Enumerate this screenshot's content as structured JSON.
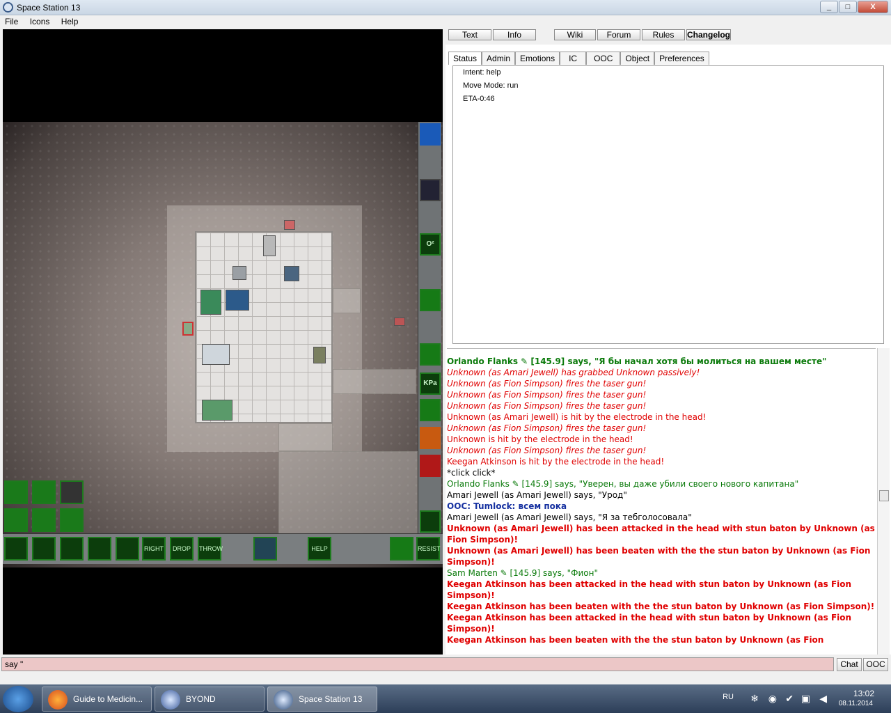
{
  "window": {
    "title": "Space Station 13",
    "buttons": [
      "_",
      "□",
      "X"
    ]
  },
  "menu": [
    "File",
    "Icons",
    "Help"
  ],
  "top_buttons": [
    "Text",
    "Info",
    "Wiki",
    "Forum",
    "Rules",
    "Changelog"
  ],
  "tabs": [
    "Status",
    "Admin",
    "Emotions",
    "IC",
    "OOC",
    "Object",
    "Preferences"
  ],
  "status": [
    "Intent: help",
    "Move Mode: run",
    "ETA-0:46"
  ],
  "hud": {
    "side": [
      "",
      "",
      "O²",
      "",
      "",
      "KPa",
      "",
      "",
      "",
      ""
    ],
    "bottom": [
      "RIGHT",
      "DROP",
      "THROW",
      "HELP",
      "RESIST"
    ]
  },
  "chat": [
    {
      "style": "g",
      "name": "Orlando Flanks",
      "text": "Orlando Flanks ✎ [145.9] says, \"Я бы начал хотя бы молиться на вашем месте\""
    },
    {
      "style": "r",
      "text": "Unknown (as Amari Jewell) has grabbed Unknown passively!"
    },
    {
      "style": "r",
      "text": "Unknown (as Fion Simpson) fires the taser gun!"
    },
    {
      "style": "r",
      "text": "Unknown (as Fion Simpson) fires the taser gun!"
    },
    {
      "style": "r",
      "text": "Unknown (as Fion Simpson) fires the taser gun!"
    },
    {
      "style": "n",
      "text": "Unknown (as Amari Jewell) is hit by the electrode in the head!"
    },
    {
      "style": "r",
      "text": "Unknown (as Fion Simpson) fires the taser gun!"
    },
    {
      "style": "n",
      "text": "Unknown is hit by the electrode in the head!"
    },
    {
      "style": "r",
      "text": "Unknown (as Fion Simpson) fires the taser gun!"
    },
    {
      "style": "n",
      "text": "Keegan Atkinson is hit by the electrode in the head!"
    },
    {
      "style": "k",
      "text": "*click click*"
    },
    {
      "style": "g",
      "text": "Orlando Flanks ✎ [145.9] says, \"Уверен, вы даже убили своего нового капитана\""
    },
    {
      "style": "k",
      "text": "Amari Jewell (as Amari Jewell) says, \"Урод\""
    },
    {
      "style": "b",
      "text": "OOC: Tumlock: всем пока"
    },
    {
      "style": "k",
      "text": "Amari Jewell (as Amari Jewell) says, \"Я за тебголосовала\""
    },
    {
      "style": "rb",
      "text": "Unknown (as Amari Jewell) has been attacked in the head with stun baton by Unknown (as Fion Simpson)!"
    },
    {
      "style": "rb",
      "text": "Unknown (as Amari Jewell) has been beaten with the the stun baton by Unknown (as Fion Simpson)!"
    },
    {
      "style": "g",
      "text": "Sam Marten ✎ [145.9] says, \"Фион\""
    },
    {
      "style": "rb",
      "text": "Keegan Atkinson has been attacked in the head with stun baton by Unknown (as Fion Simpson)!"
    },
    {
      "style": "rb",
      "text": "Keegan Atkinson has been beaten with the the stun baton by Unknown (as Fion Simpson)!"
    },
    {
      "style": "rb",
      "text": "Keegan Atkinson has been attacked in the head with stun baton by Unknown (as Fion Simpson)!"
    },
    {
      "style": "rb",
      "text": "Keegan Atkinson has been beaten with the the stun baton by Unknown (as Fion"
    }
  ],
  "input": {
    "value": "say \"",
    "chat_label": "Chat",
    "ooc_label": "OOC"
  },
  "taskbar": {
    "items": [
      "Guide to Medicin...",
      "BYOND",
      "Space Station 13"
    ],
    "lang": "RU",
    "time": "13:02",
    "date": "08.11.2014"
  }
}
